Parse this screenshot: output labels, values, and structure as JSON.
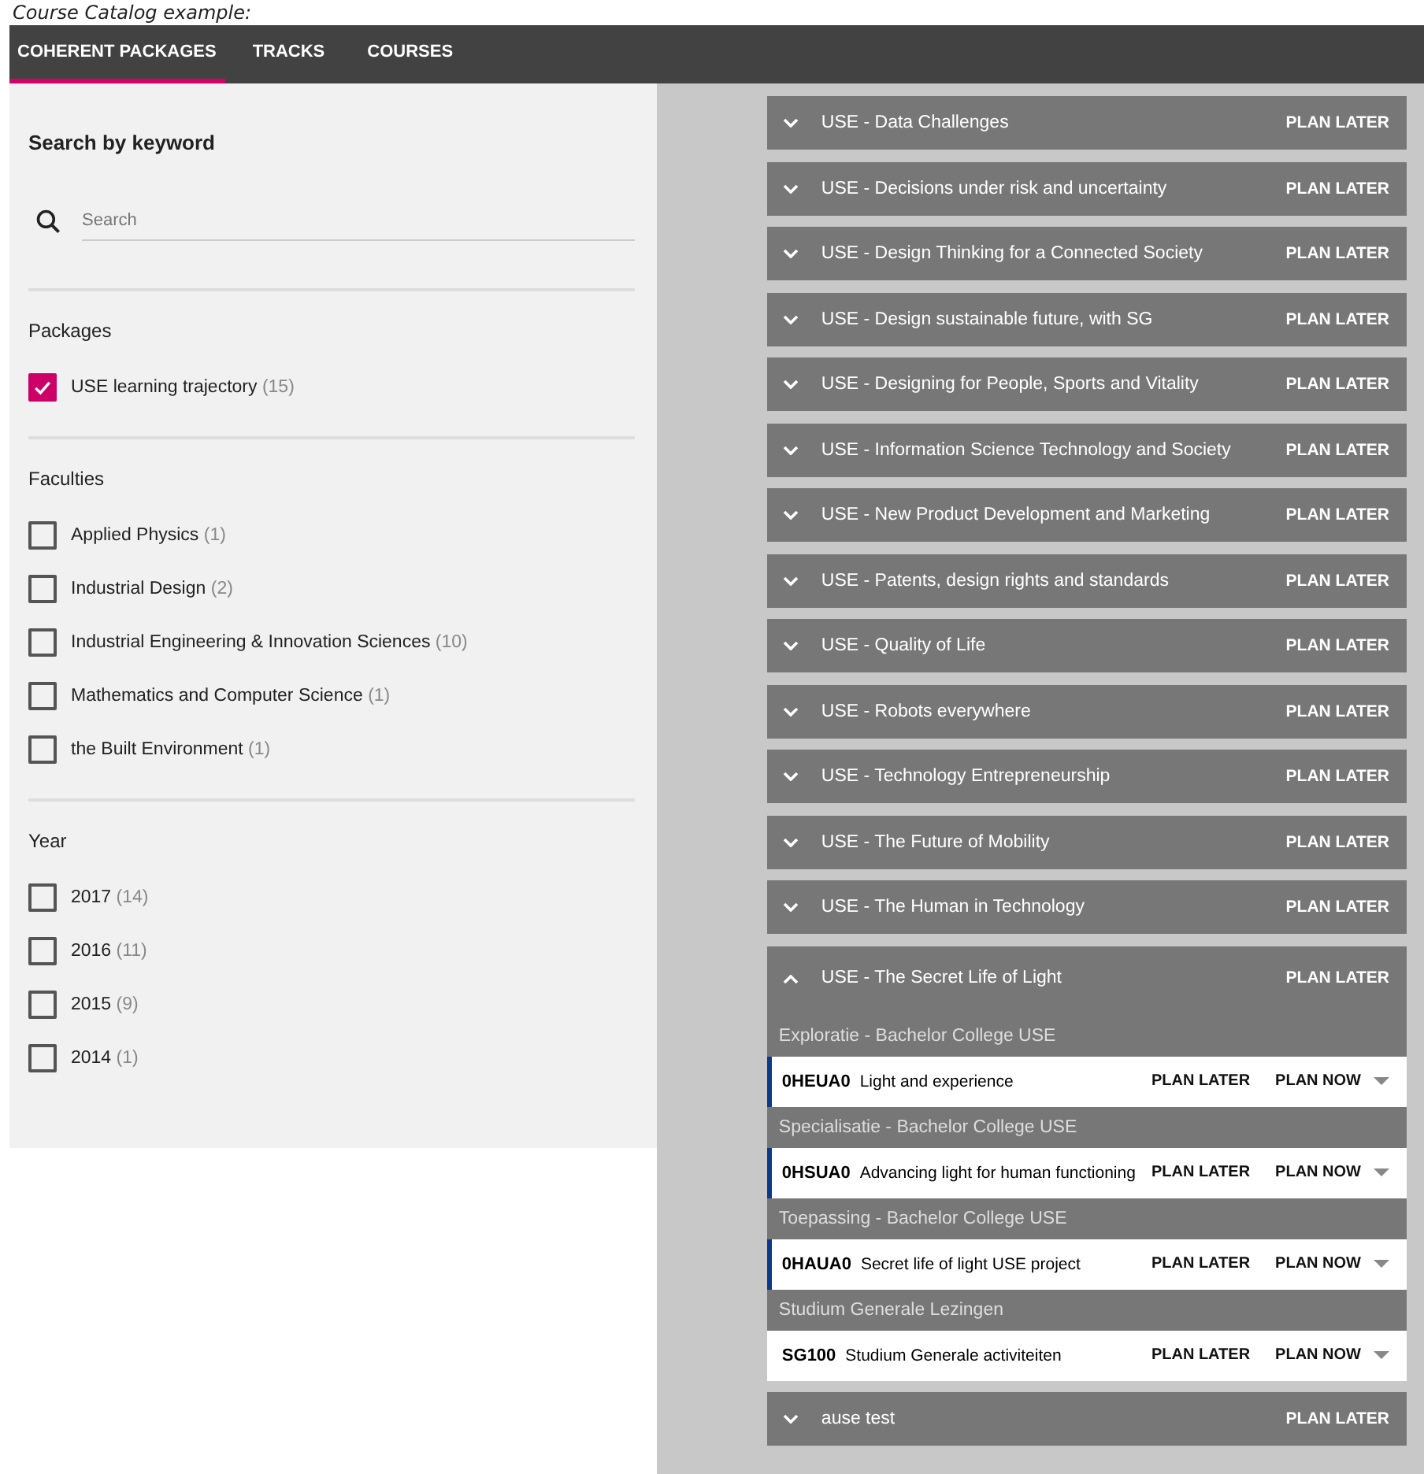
{
  "caption": "Course Catalog example:",
  "tabs": [
    {
      "label": "COHERENT PACKAGES",
      "selected": true
    },
    {
      "label": "TRACKS",
      "selected": false
    },
    {
      "label": "COURSES",
      "selected": false
    }
  ],
  "search": {
    "title": "Search by keyword",
    "placeholder": "Search"
  },
  "filters": [
    {
      "title": "Packages",
      "items": [
        {
          "label": "USE learning trajectory",
          "count": "(15)",
          "checked": true
        }
      ]
    },
    {
      "title": "Faculties",
      "items": [
        {
          "label": "Applied Physics",
          "count": "(1)",
          "checked": false
        },
        {
          "label": "Industrial Design",
          "count": "(2)",
          "checked": false
        },
        {
          "label": "Industrial Engineering & Innovation Sciences",
          "count": "(10)",
          "checked": false
        },
        {
          "label": "Mathematics and Computer Science",
          "count": "(1)",
          "checked": false
        },
        {
          "label": "the Built Environment",
          "count": "(1)",
          "checked": false
        }
      ]
    },
    {
      "title": "Year",
      "items": [
        {
          "label": "2017",
          "count": "(14)",
          "checked": false
        },
        {
          "label": "2016",
          "count": "(11)",
          "checked": false
        },
        {
          "label": "2015",
          "count": "(9)",
          "checked": false
        },
        {
          "label": "2014",
          "count": "(1)",
          "checked": false
        }
      ]
    }
  ],
  "packages": [
    {
      "title": "USE - Data Challenges",
      "action": "PLAN LATER",
      "expanded": false
    },
    {
      "title": "USE - Decisions under risk and uncertainty",
      "action": "PLAN LATER",
      "expanded": false
    },
    {
      "title": "USE - Design Thinking for a Connected Society",
      "action": "PLAN LATER",
      "expanded": false
    },
    {
      "title": "USE - Design sustainable future, with SG",
      "action": "PLAN LATER",
      "expanded": false
    },
    {
      "title": "USE - Designing for People, Sports and Vitality",
      "action": "PLAN LATER",
      "expanded": false
    },
    {
      "title": "USE - Information Science Technology and Society",
      "action": "PLAN LATER",
      "expanded": false
    },
    {
      "title": "USE - New Product Development and Marketing",
      "action": "PLAN LATER",
      "expanded": false
    },
    {
      "title": "USE - Patents, design rights and standards",
      "action": "PLAN LATER",
      "expanded": false
    },
    {
      "title": "USE - Quality of Life",
      "action": "PLAN LATER",
      "expanded": false
    },
    {
      "title": "USE - Robots everywhere",
      "action": "PLAN LATER",
      "expanded": false
    },
    {
      "title": "USE - Technology Entrepreneurship",
      "action": "PLAN LATER",
      "expanded": false
    },
    {
      "title": "USE - The Future of Mobility",
      "action": "PLAN LATER",
      "expanded": false
    },
    {
      "title": "USE - The Human in Technology",
      "action": "PLAN LATER",
      "expanded": false
    },
    {
      "title": "USE - The Secret Life of Light",
      "action": "PLAN LATER",
      "expanded": true,
      "groups": [
        {
          "title": "Exploratie - Bachelor College USE",
          "courses": [
            {
              "code": "0HEUA0",
              "name": "Light and experience",
              "later": "PLAN LATER",
              "now": "PLAN NOW",
              "marked": true
            }
          ]
        },
        {
          "title": "Specialisatie - Bachelor College USE",
          "courses": [
            {
              "code": "0HSUA0",
              "name": "Advancing light for human functioning",
              "later": "PLAN LATER",
              "now": "PLAN NOW",
              "marked": true
            }
          ]
        },
        {
          "title": "Toepassing - Bachelor College USE",
          "courses": [
            {
              "code": "0HAUA0",
              "name": "Secret life of light USE project",
              "later": "PLAN LATER",
              "now": "PLAN NOW",
              "marked": true
            }
          ]
        },
        {
          "title": "Studium Generale Lezingen",
          "courses": [
            {
              "code": "SG100",
              "name": "Studium Generale activiteiten",
              "later": "PLAN LATER",
              "now": "PLAN NOW",
              "marked": false
            }
          ]
        }
      ]
    },
    {
      "title": "ause test",
      "action": "PLAN LATER",
      "expanded": false
    }
  ]
}
